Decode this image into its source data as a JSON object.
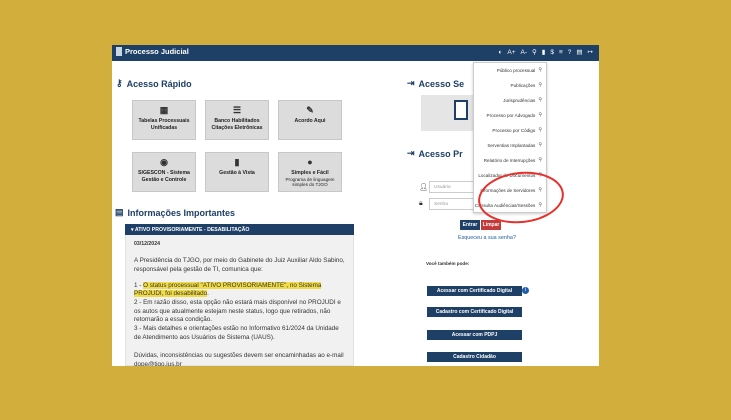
{
  "topbar": {
    "title": "Processo Judicial",
    "tools": [
      "◐",
      "A+",
      "A-",
      "⚲",
      "▮",
      "$",
      "≡",
      "?",
      "▤",
      "↦"
    ]
  },
  "acesso_rapido": {
    "title": "Acesso Rápido",
    "tiles": [
      {
        "icon": "table-icon",
        "glyph": "▦",
        "label": "Tabelas Processuais Unificadas",
        "sub": ""
      },
      {
        "icon": "list-icon",
        "glyph": "☰",
        "label": "Banco Habilitados Citações Eletrônicas",
        "sub": ""
      },
      {
        "icon": "edit-icon",
        "glyph": "✎",
        "label": "Acordo Aqui",
        "sub": ""
      },
      {
        "icon": "sigescon-logo-icon",
        "glyph": "◉",
        "label": "SIGESCON - Sistema Gestão e Controle",
        "sub": ""
      },
      {
        "icon": "bar-chart-icon",
        "glyph": "▮",
        "label": "Gestão à Vista",
        "sub": ""
      },
      {
        "icon": "chat-icon",
        "glyph": "●",
        "label": "Simples e Fácil",
        "sub": "Programa de linguagem simples do TJGO"
      }
    ]
  },
  "acesso_sistema": {
    "title": "Acesso Se"
  },
  "acesso_projudi": {
    "title": "Acesso Pr",
    "user_placeholder": "Usuário",
    "password_placeholder": "Senha",
    "enter_label": "Entrar",
    "clear_label": "Limpar",
    "forgot_label": "Esqueceu a sua senha?",
    "also_label": "Você também pode:",
    "cert_label": "Acessar com Certificado Digital",
    "register_cert_label": "Cadastro com Certificado Digital",
    "pdpj_label": "Acessar com PDPJ",
    "citizen_label": "Cadastro Cidadão"
  },
  "informacoes": {
    "title": "Informações Importantes",
    "banner": "ATIVO PROVISORIAMENTE - DESABILITAÇÃO",
    "date": "03/12/2024",
    "intro": "A Presidência do TJGO, por meio do Gabinete do Juiz Auxiliar Aldo Sabino, responsável pela gestão de TI, comunica que:",
    "item1_prefix": "1 - ",
    "item1_hl": "O status processual \"ATIVO PROVISORIAMENTE\", no Sistema PROJUDI, foi desabilitado",
    "item1_suffix": ".",
    "item2": "2 - Em razão disso, esta opção não estará mais disponível no PROJUDI e os autos que atualmente estejam neste status, logo que retirados, não retornarão a essa condição.",
    "item3": "3 - Mais detalhes e orientações estão no Informativo 61/2024 da Unidade de Atendimento aos Usuários de Sistema (UAUS).",
    "closing": "Dúvidas, inconsistências ou sugestões devem ser encaminhadas ao e-mail dope@tjgo.jus.br"
  },
  "menu": {
    "items": [
      "Público processual",
      "Publicações",
      "Jurisprudências",
      "Processo por Advogado",
      "Processo por Código",
      "Serventias Implantadas",
      "Relatório de Interrupções",
      "Localizador de Documentos",
      "Informações de Servidores",
      "Consulta Audiências/Sessões"
    ]
  },
  "colors": {
    "navy": "#1e3f66",
    "background": "#d2ae3c",
    "highlight": "#f1dc48",
    "annotation": "#e6302b"
  }
}
